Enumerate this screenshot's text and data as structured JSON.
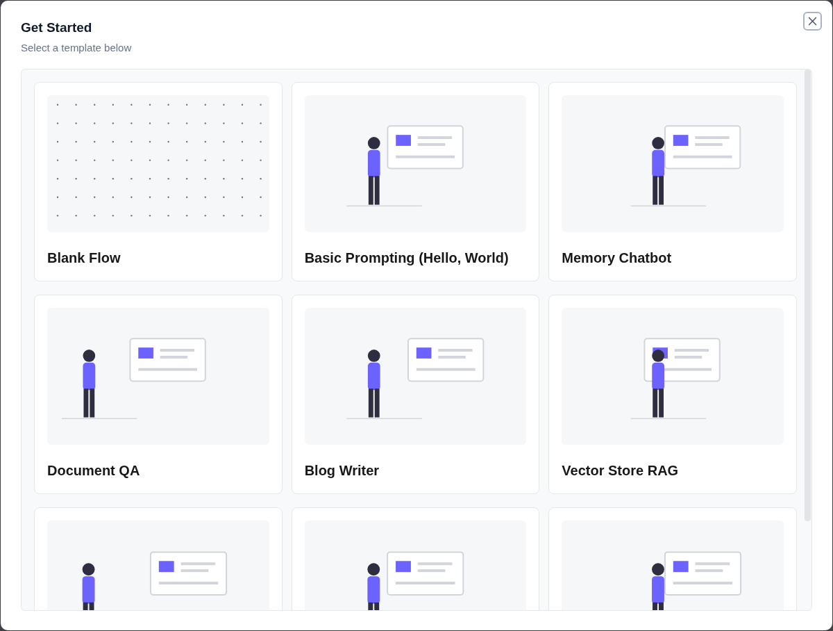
{
  "dialog": {
    "title": "Get Started",
    "subtitle": "Select a template below"
  },
  "templates": [
    {
      "title": "Blank Flow",
      "kind": "blank"
    },
    {
      "title": "Basic Prompting (Hello, World)",
      "kind": "illustration"
    },
    {
      "title": "Memory Chatbot",
      "kind": "illustration"
    },
    {
      "title": "Document QA",
      "kind": "illustration"
    },
    {
      "title": "Blog Writer",
      "kind": "illustration"
    },
    {
      "title": "Vector Store RAG",
      "kind": "illustration"
    },
    {
      "kind": "illustration"
    },
    {
      "kind": "illustration"
    },
    {
      "kind": "illustration"
    }
  ]
}
